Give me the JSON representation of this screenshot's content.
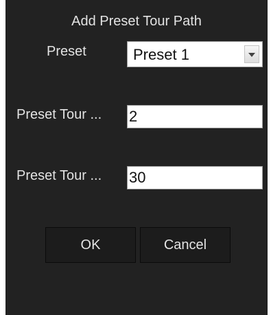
{
  "dialog": {
    "title": "Add Preset Tour Path"
  },
  "form": {
    "preset": {
      "label": "Preset",
      "selected": "Preset 1",
      "arrow_icon": "chevron-down-icon"
    },
    "tour_field_1": {
      "label": "Preset Tour ...",
      "value": "2"
    },
    "tour_field_2": {
      "label": "Preset Tour ...",
      "value": "30"
    }
  },
  "buttons": {
    "ok_label": "OK",
    "cancel_label": "Cancel"
  },
  "colors": {
    "dialog_background": "#222222",
    "text": "#e3e3e3",
    "input_background": "#ffffff",
    "button_background": "#1c1c1c"
  }
}
